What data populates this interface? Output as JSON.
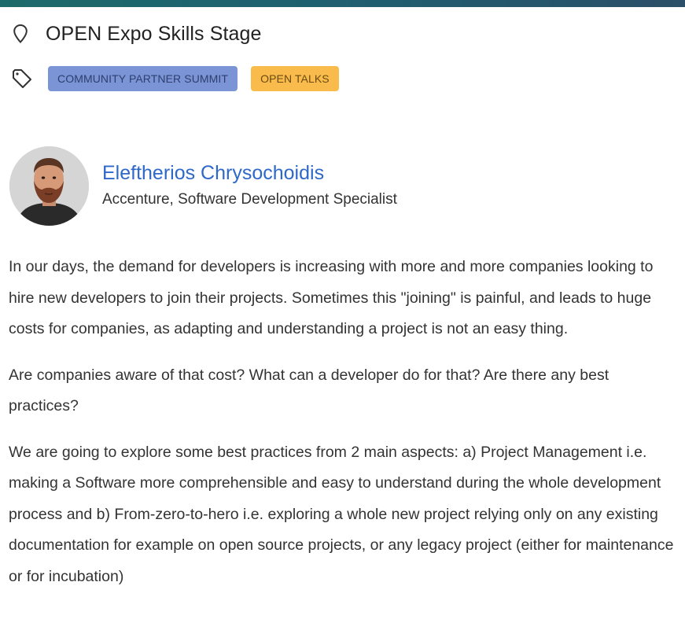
{
  "location": {
    "icon": "map-pin-icon",
    "title": "OPEN Expo Skills Stage"
  },
  "tags": {
    "icon": "tag-icon",
    "items": [
      {
        "label": "COMMUNITY PARTNER SUMMIT",
        "color": "#7a94d6"
      },
      {
        "label": "OPEN TALKS",
        "color": "#f9bc4c"
      }
    ]
  },
  "speaker": {
    "name": "Eleftherios Chrysochoidis",
    "role": "Accenture, Software Development Specialist",
    "name_color": "#2e68c9"
  },
  "description": {
    "paragraphs": [
      "In our days, the demand for developers is increasing with more and more companies looking to hire new developers to join their projects. Sometimes this \"joining\" is painful, and leads to huge costs for companies, as adapting and understanding a project is not an easy thing.",
      "Are companies aware of that cost? What can a developer do for that? Are there any best practices?",
      "We are going to explore some best practices from 2 main aspects: a) Project Management i.e. making a Software more comprehensible and easy to understand during the whole development process and b) From-zero-to-hero i.e. exploring a whole new project relying only on any existing documentation for example on open source projects, or any legacy project (either for maintenance or for incubation)"
    ]
  }
}
